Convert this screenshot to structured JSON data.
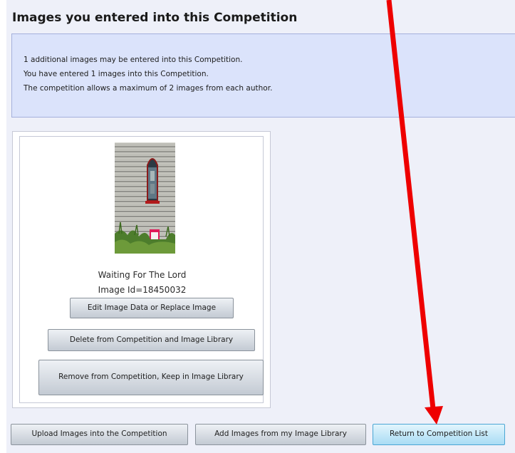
{
  "section": {
    "title": "Images you entered into this Competition"
  },
  "info": {
    "line1": "1 additional images may be entered into this Competition.",
    "line2": "You have entered 1 images into this Competition.",
    "line3": "The competition allows a maximum of 2 images from each author."
  },
  "entry": {
    "image_alt": "Waiting For The Lord",
    "title": "Waiting For The Lord",
    "image_id": "Image Id=18450032",
    "edit_label": "Edit Image Data or Replace Image",
    "delete_label": "Delete from Competition and Image Library",
    "remove_label": "Remove from Competition, Keep in Image Library"
  },
  "actions": {
    "upload_label": "Upload Images into the Competition",
    "add_label": "Add Images from my Image Library",
    "return_label": "Return to Competition List"
  },
  "colors": {
    "panel_bg": "#eef0f9",
    "info_bg": "#dbe3fb",
    "annotation_arrow": "#ee0000",
    "highlight_button": "#a9dcf4"
  }
}
